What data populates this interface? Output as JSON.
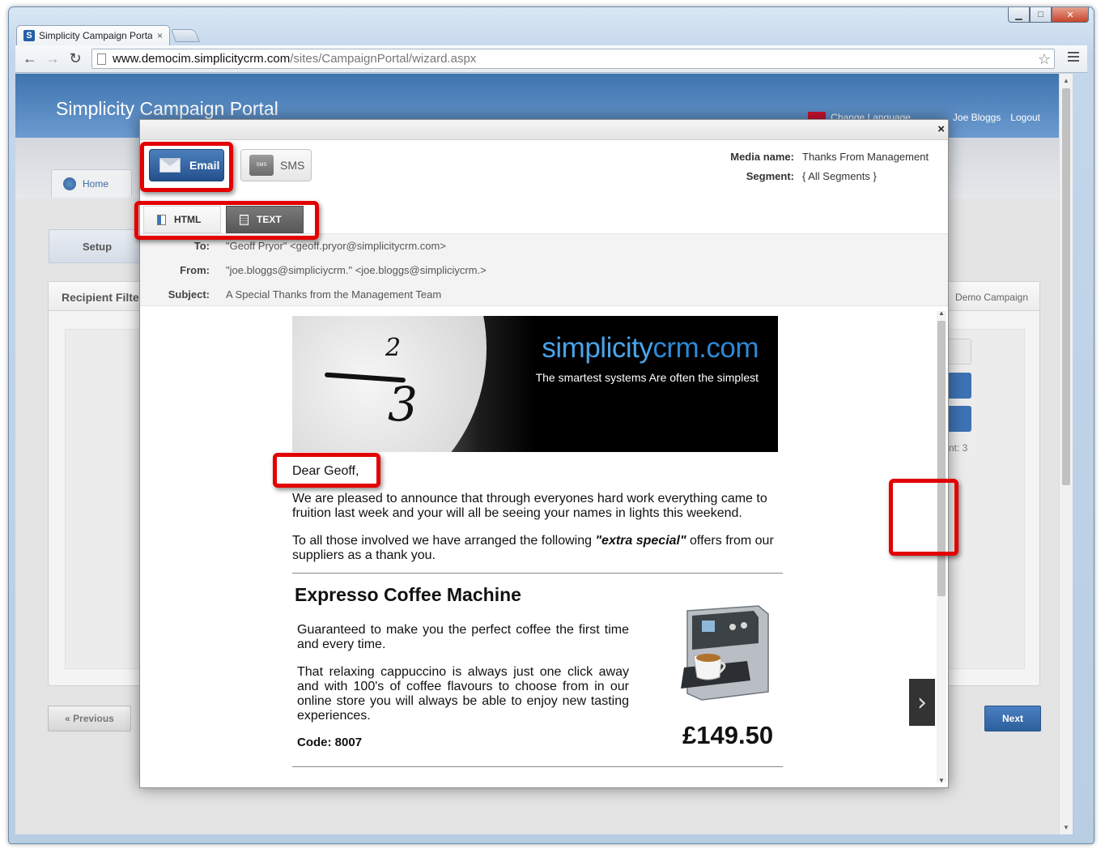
{
  "browser": {
    "tab_title": "Simplicity Campaign Portal",
    "tab_close": "×",
    "url_host": "www.democim.simplicitycrm.com",
    "url_path": "/sites/CampaignPortal/wizard.aspx",
    "window_min": "▁",
    "window_max": "□",
    "window_close": "✕"
  },
  "app": {
    "title": "Simplicity Campaign Portal",
    "change_language": "Change Language",
    "user_name": "Joe Bloggs",
    "logout": "Logout",
    "home_tab": "Home",
    "step_setup": "Setup",
    "panel_title": "Recipient Filter",
    "panel_right_title": "Demo Campaign",
    "count_fragment": "nt: 3",
    "previous": "« Previous",
    "next": "Next"
  },
  "modal": {
    "close": "×",
    "channel_email": "Email",
    "channel_sms": "SMS",
    "sms_icon_text": "SMS",
    "media_name_label": "Media name:",
    "media_name": "Thanks From Management",
    "segment_label": "Segment:",
    "segment": "{ All Segments }",
    "format_html": "HTML",
    "format_text": "TEXT",
    "to_label": "To:",
    "to": "\"Geoff Pryor\" <geoff.pryor@simplicitycrm.com>",
    "from_label": "From:",
    "from": "\"joe.bloggs@simpliciycrm.\" <joe.bloggs@simpliciycrm.>",
    "subject_label": "Subject:",
    "subject": "A Special Thanks from the Management Team",
    "next_arrow": "›"
  },
  "email": {
    "brand_simplicity": "simplicity",
    "brand_crm": "crm.com",
    "tagline": "The smartest systems Are often the simplest",
    "clock_2": "2",
    "clock_3": "3",
    "greeting": "Dear Geoff,",
    "para1": "We are pleased to announce that through everyones hard work everything came to fruition last week and your will all be seeing your names in lights this weekend.",
    "para2_before": "To all those involved we have arranged the following ",
    "para2_emph": "\"extra special\"",
    "para2_after": " offers from our suppliers as a thank you.",
    "product_title": "Expresso Coffee Machine",
    "product_desc1": "Guaranteed to make you the perfect coffee the first time and every time.",
    "product_desc2": "That relaxing cappuccino is always just one click away and with 100's of coffee flavours to choose from in our online store you will always be able to enjoy new tasting experiences.",
    "code": "Code: 8007",
    "price": "£149.50"
  },
  "colors": {
    "header_blue": "#3f74ae",
    "email_button": "#23508c",
    "callout_red": "#e30000",
    "brand_blue": "#4aa3e8"
  }
}
